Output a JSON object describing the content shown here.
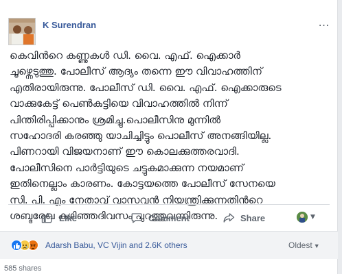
{
  "post": {
    "author": "K Surendran",
    "more_icon": "…",
    "text_lines": [
      "കെവിൻറെ കണ്ണുകൾ ഡി. വൈ. എഫ്. ഐക്കാർ",
      "ചൂഴ്ന്നെടുത്തു. പോലീസ് ആദ്യം തന്നെ ഈ വിവാഹത്തിന്",
      "എതിരായിരുന്നു. പോലീസ് ഡി. വൈ. എഫ്. ഐക്കാരുടെ",
      "വാക്കുകേട്ട് പെൺകുട്ടിയെ വിവാഹത്തിൽ നിന്ന്",
      "പിന്തിരിപ്പിക്കാനും ശ്രമിച്ചു.പൊലീസിനു മുന്നിൽ",
      "സഹോദരി കരഞ്ഞു യാചിച്ചിട്ടും പൊലീസ് അനങ്ങിയില്ല.",
      "പിണറായി വിജയനാണ് ഈ കൊലക്കുത്തരവാദി.",
      "പോലീസിനെ പാർട്ടിയുടെ ചട്ടുകമാക്കുന്ന നയമാണ്",
      "ഇതിനെല്ലാം കാരണം. കോട്ടയത്തെ പോലീസ് സേനയെ",
      "സി. പി. എം നേതാവ് വാസവൻ നിയന്ത്രിക്കുന്നതിൻറെ",
      "ശബ്ദരേഖ കഴിഞ്ഞദിവസം പുറത്തുവന്നിരുന്നു."
    ]
  },
  "actions": {
    "like_label": "Like",
    "comment_label": "Comment",
    "share_label": "Share"
  },
  "reactions": {
    "icons": [
      "like-reaction-icon",
      "sad-reaction-icon",
      "angry-reaction-icon"
    ],
    "names": "Adarsh Babu, VC Vijin and 2.6K others",
    "sort_label": "Oldest"
  },
  "shares_text": "585 shares",
  "colors": {
    "link": "#365899",
    "muted": "#606770",
    "like_blue": "#1877f2"
  }
}
